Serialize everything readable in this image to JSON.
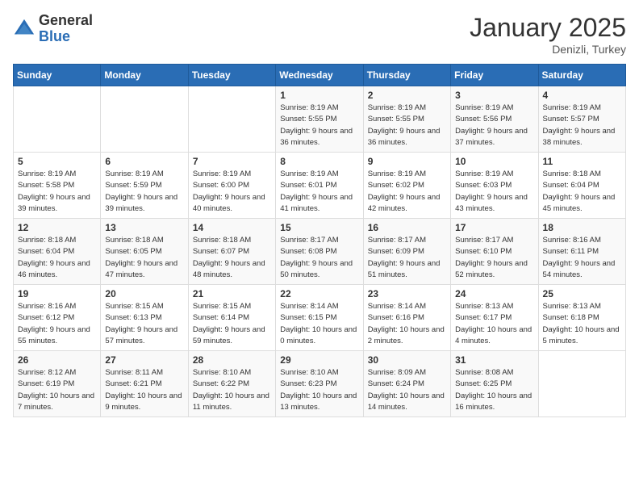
{
  "header": {
    "logo_general": "General",
    "logo_blue": "Blue",
    "month_title": "January 2025",
    "location": "Denizli, Turkey"
  },
  "days_of_week": [
    "Sunday",
    "Monday",
    "Tuesday",
    "Wednesday",
    "Thursday",
    "Friday",
    "Saturday"
  ],
  "weeks": [
    [
      {
        "day": "",
        "sunrise": "",
        "sunset": "",
        "daylight": ""
      },
      {
        "day": "",
        "sunrise": "",
        "sunset": "",
        "daylight": ""
      },
      {
        "day": "",
        "sunrise": "",
        "sunset": "",
        "daylight": ""
      },
      {
        "day": "1",
        "sunrise": "Sunrise: 8:19 AM",
        "sunset": "Sunset: 5:55 PM",
        "daylight": "Daylight: 9 hours and 36 minutes."
      },
      {
        "day": "2",
        "sunrise": "Sunrise: 8:19 AM",
        "sunset": "Sunset: 5:55 PM",
        "daylight": "Daylight: 9 hours and 36 minutes."
      },
      {
        "day": "3",
        "sunrise": "Sunrise: 8:19 AM",
        "sunset": "Sunset: 5:56 PM",
        "daylight": "Daylight: 9 hours and 37 minutes."
      },
      {
        "day": "4",
        "sunrise": "Sunrise: 8:19 AM",
        "sunset": "Sunset: 5:57 PM",
        "daylight": "Daylight: 9 hours and 38 minutes."
      }
    ],
    [
      {
        "day": "5",
        "sunrise": "Sunrise: 8:19 AM",
        "sunset": "Sunset: 5:58 PM",
        "daylight": "Daylight: 9 hours and 39 minutes."
      },
      {
        "day": "6",
        "sunrise": "Sunrise: 8:19 AM",
        "sunset": "Sunset: 5:59 PM",
        "daylight": "Daylight: 9 hours and 39 minutes."
      },
      {
        "day": "7",
        "sunrise": "Sunrise: 8:19 AM",
        "sunset": "Sunset: 6:00 PM",
        "daylight": "Daylight: 9 hours and 40 minutes."
      },
      {
        "day": "8",
        "sunrise": "Sunrise: 8:19 AM",
        "sunset": "Sunset: 6:01 PM",
        "daylight": "Daylight: 9 hours and 41 minutes."
      },
      {
        "day": "9",
        "sunrise": "Sunrise: 8:19 AM",
        "sunset": "Sunset: 6:02 PM",
        "daylight": "Daylight: 9 hours and 42 minutes."
      },
      {
        "day": "10",
        "sunrise": "Sunrise: 8:19 AM",
        "sunset": "Sunset: 6:03 PM",
        "daylight": "Daylight: 9 hours and 43 minutes."
      },
      {
        "day": "11",
        "sunrise": "Sunrise: 8:18 AM",
        "sunset": "Sunset: 6:04 PM",
        "daylight": "Daylight: 9 hours and 45 minutes."
      }
    ],
    [
      {
        "day": "12",
        "sunrise": "Sunrise: 8:18 AM",
        "sunset": "Sunset: 6:04 PM",
        "daylight": "Daylight: 9 hours and 46 minutes."
      },
      {
        "day": "13",
        "sunrise": "Sunrise: 8:18 AM",
        "sunset": "Sunset: 6:05 PM",
        "daylight": "Daylight: 9 hours and 47 minutes."
      },
      {
        "day": "14",
        "sunrise": "Sunrise: 8:18 AM",
        "sunset": "Sunset: 6:07 PM",
        "daylight": "Daylight: 9 hours and 48 minutes."
      },
      {
        "day": "15",
        "sunrise": "Sunrise: 8:17 AM",
        "sunset": "Sunset: 6:08 PM",
        "daylight": "Daylight: 9 hours and 50 minutes."
      },
      {
        "day": "16",
        "sunrise": "Sunrise: 8:17 AM",
        "sunset": "Sunset: 6:09 PM",
        "daylight": "Daylight: 9 hours and 51 minutes."
      },
      {
        "day": "17",
        "sunrise": "Sunrise: 8:17 AM",
        "sunset": "Sunset: 6:10 PM",
        "daylight": "Daylight: 9 hours and 52 minutes."
      },
      {
        "day": "18",
        "sunrise": "Sunrise: 8:16 AM",
        "sunset": "Sunset: 6:11 PM",
        "daylight": "Daylight: 9 hours and 54 minutes."
      }
    ],
    [
      {
        "day": "19",
        "sunrise": "Sunrise: 8:16 AM",
        "sunset": "Sunset: 6:12 PM",
        "daylight": "Daylight: 9 hours and 55 minutes."
      },
      {
        "day": "20",
        "sunrise": "Sunrise: 8:15 AM",
        "sunset": "Sunset: 6:13 PM",
        "daylight": "Daylight: 9 hours and 57 minutes."
      },
      {
        "day": "21",
        "sunrise": "Sunrise: 8:15 AM",
        "sunset": "Sunset: 6:14 PM",
        "daylight": "Daylight: 9 hours and 59 minutes."
      },
      {
        "day": "22",
        "sunrise": "Sunrise: 8:14 AM",
        "sunset": "Sunset: 6:15 PM",
        "daylight": "Daylight: 10 hours and 0 minutes."
      },
      {
        "day": "23",
        "sunrise": "Sunrise: 8:14 AM",
        "sunset": "Sunset: 6:16 PM",
        "daylight": "Daylight: 10 hours and 2 minutes."
      },
      {
        "day": "24",
        "sunrise": "Sunrise: 8:13 AM",
        "sunset": "Sunset: 6:17 PM",
        "daylight": "Daylight: 10 hours and 4 minutes."
      },
      {
        "day": "25",
        "sunrise": "Sunrise: 8:13 AM",
        "sunset": "Sunset: 6:18 PM",
        "daylight": "Daylight: 10 hours and 5 minutes."
      }
    ],
    [
      {
        "day": "26",
        "sunrise": "Sunrise: 8:12 AM",
        "sunset": "Sunset: 6:19 PM",
        "daylight": "Daylight: 10 hours and 7 minutes."
      },
      {
        "day": "27",
        "sunrise": "Sunrise: 8:11 AM",
        "sunset": "Sunset: 6:21 PM",
        "daylight": "Daylight: 10 hours and 9 minutes."
      },
      {
        "day": "28",
        "sunrise": "Sunrise: 8:10 AM",
        "sunset": "Sunset: 6:22 PM",
        "daylight": "Daylight: 10 hours and 11 minutes."
      },
      {
        "day": "29",
        "sunrise": "Sunrise: 8:10 AM",
        "sunset": "Sunset: 6:23 PM",
        "daylight": "Daylight: 10 hours and 13 minutes."
      },
      {
        "day": "30",
        "sunrise": "Sunrise: 8:09 AM",
        "sunset": "Sunset: 6:24 PM",
        "daylight": "Daylight: 10 hours and 14 minutes."
      },
      {
        "day": "31",
        "sunrise": "Sunrise: 8:08 AM",
        "sunset": "Sunset: 6:25 PM",
        "daylight": "Daylight: 10 hours and 16 minutes."
      },
      {
        "day": "",
        "sunrise": "",
        "sunset": "",
        "daylight": ""
      }
    ]
  ]
}
